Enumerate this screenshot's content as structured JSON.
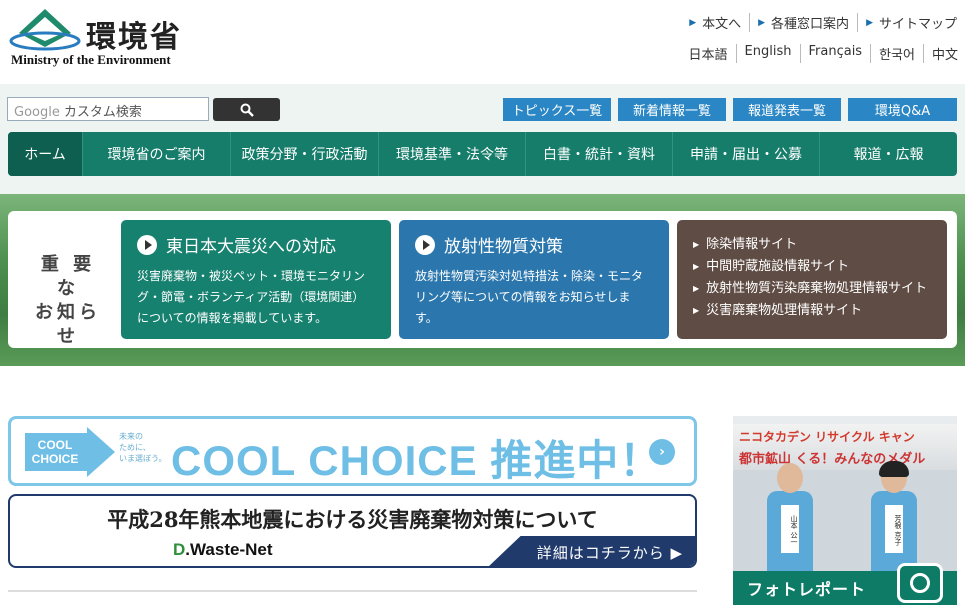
{
  "header": {
    "logo_kanji": "環境省",
    "logo_en": "Ministry of the Environment",
    "util_links": [
      "本文へ",
      "各種窓口案内",
      "サイトマップ"
    ],
    "languages": [
      "日本語",
      "English",
      "Français",
      "한국어",
      "中文"
    ]
  },
  "search": {
    "placeholder_prefix": "Google",
    "placeholder": "カスタム検索",
    "button_icon": "search-icon"
  },
  "quick_links": [
    "トピックス一覧",
    "新着情報一覧",
    "報道発表一覧",
    "環境Q&A"
  ],
  "nav": [
    "ホーム",
    "環境省のご案内",
    "政策分野・行政活動",
    "環境基準・法令等",
    "白書・統計・資料",
    "申請・届出・公募",
    "報道・広報"
  ],
  "notices": {
    "label_line1": "重 要 な",
    "label_line2": "お知らせ",
    "cards": [
      {
        "title": "東日本大震災への対応",
        "desc": "災害廃棄物・被災ペット・環境モニタリング・節電・ボランティア活動（環境関連）についての情報を掲載しています。"
      },
      {
        "title": "放射性物質対策",
        "desc": "放射性物質汚染対処特措法・除染・モニタリング等についての情報をお知らせします。"
      }
    ],
    "links": [
      "除染情報サイト",
      "中間貯蔵施設情報サイト",
      "放射性物質汚染廃棄物処理情報サイト",
      "災害廃棄物処理情報サイト"
    ]
  },
  "banners": {
    "cool_arrow_line1": "COOL",
    "cool_arrow_line2": "CHOICE",
    "cool_sub": "未来の\nために、\nいま選ぼう。",
    "cool_main": "COOL CHOICE 推進中！",
    "waste_title": "平成28年熊本地震における災害廃棄物対策について",
    "waste_logo_d": "D",
    "waste_logo_rest": ".Waste-Net",
    "waste_more": "詳細はコチラから ▶"
  },
  "photo_report": {
    "label": "フォトレポート",
    "banner_text1": "ニコタカデン リサイクル キャン",
    "banner_text2": "都市鉱山 くる！みんなのメダル",
    "tag_left": "山本 公一",
    "tag_right": "芳根 京子"
  },
  "colors": {
    "nav_green": "#177d6b",
    "quick_blue": "#2a86c4",
    "card_teal": "#178170",
    "card_blue": "#2b77ad",
    "card_brown": "#5f4c44"
  }
}
